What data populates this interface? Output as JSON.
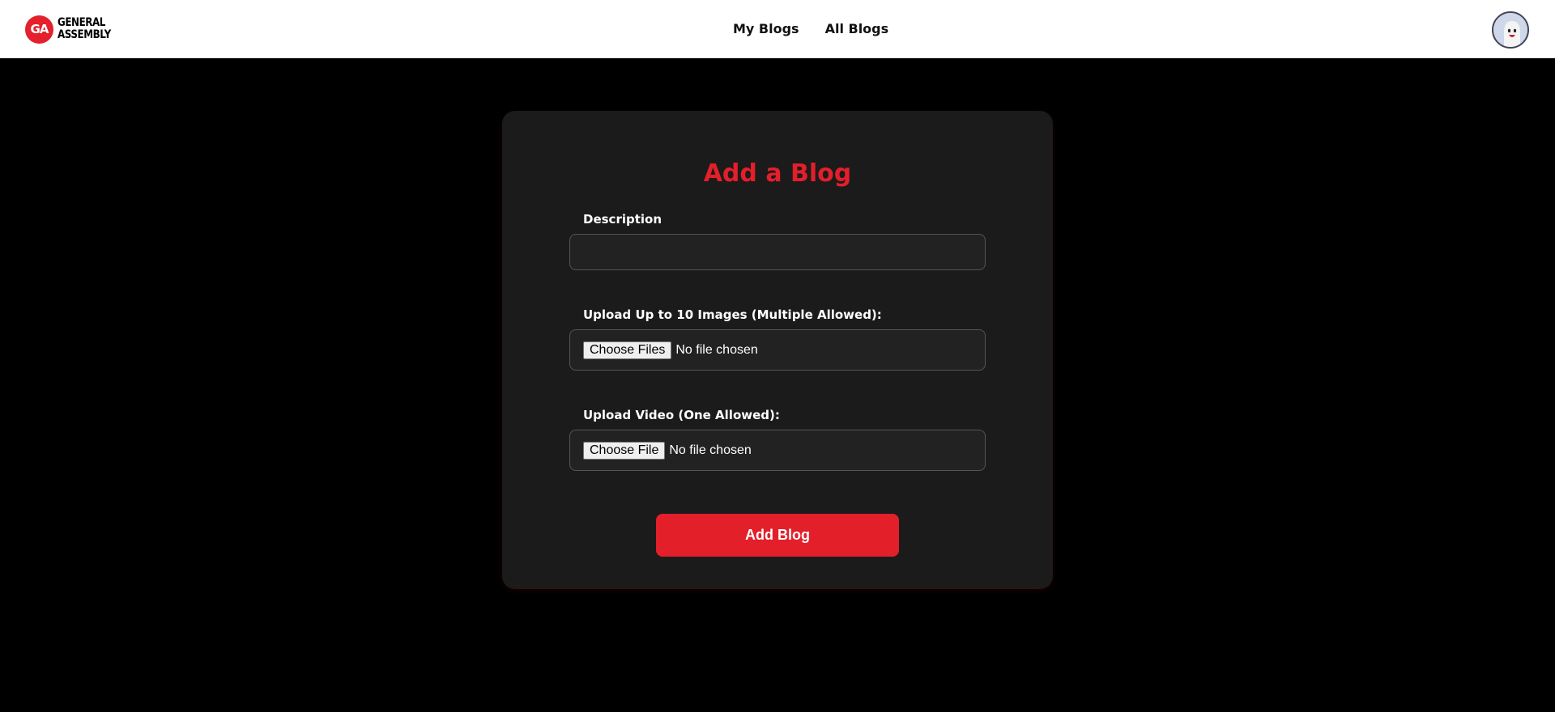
{
  "brand": {
    "badge": "GA",
    "name_line1": "GENERAL",
    "name_line2": "ASSEMBLY",
    "accent_color": "#e31f2a"
  },
  "nav": {
    "links": [
      {
        "label": "My Blogs"
      },
      {
        "label": "All Blogs"
      }
    ],
    "avatar_icon": "user-avatar-icon"
  },
  "form": {
    "title": "Add a Blog",
    "description_label": "Description",
    "description_value": "",
    "images_label": "Upload Up to 10 Images (Multiple Allowed):",
    "images_button": "Choose Files",
    "images_status": "No file chosen",
    "video_label": "Upload Video (One Allowed):",
    "video_button": "Choose File",
    "video_status": "No file chosen",
    "submit_label": "Add Blog"
  }
}
